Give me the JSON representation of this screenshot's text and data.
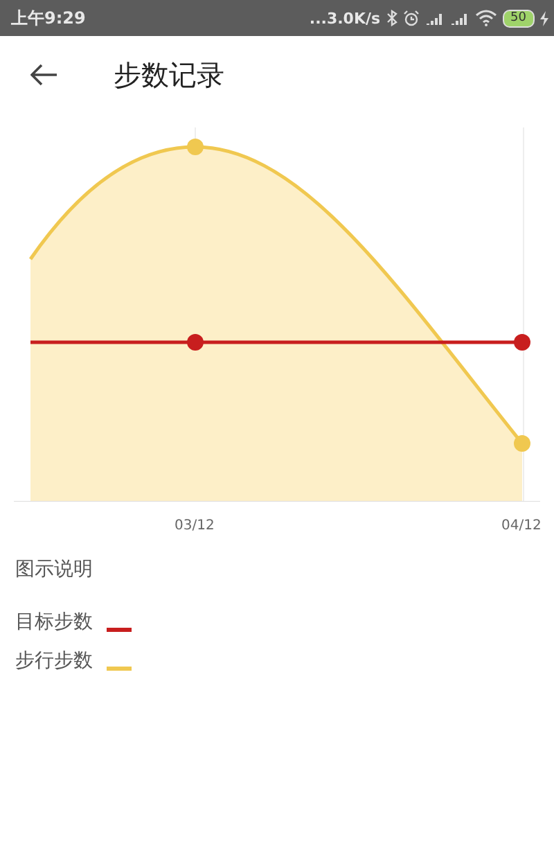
{
  "status_bar": {
    "time": "上午9:29",
    "speed": "...3.0K/s",
    "battery": "50"
  },
  "header": {
    "title": "步数记录"
  },
  "chart": {
    "x_labels": [
      "03/12",
      "04/12"
    ]
  },
  "legend": {
    "title": "图示说明",
    "items": [
      {
        "label": "目标步数",
        "color": "#c81e1e"
      },
      {
        "label": "步行步数",
        "color": "#f0c850"
      }
    ]
  }
}
